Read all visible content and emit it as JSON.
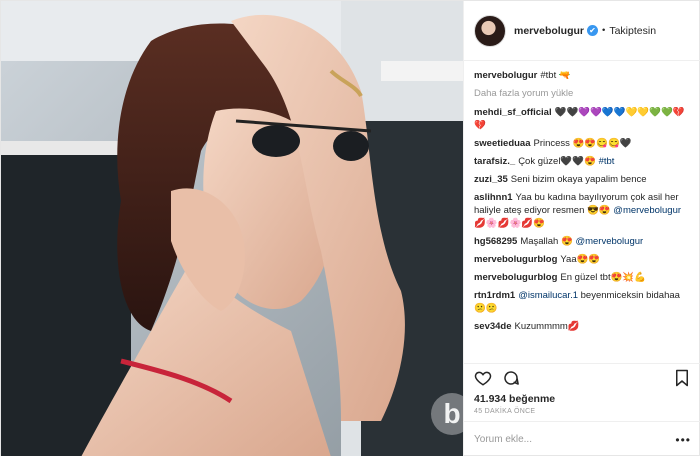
{
  "header": {
    "username": "mervebolugur",
    "verified_glyph": "✔",
    "separator": "•",
    "follow_label": "Takiptesin"
  },
  "caption": {
    "user": "mervebolugur",
    "text": "#tbt 🔫"
  },
  "load_more": "Daha fazla yorum yükle",
  "comments": [
    {
      "user": "mehdi_sf_official",
      "text": "🖤🖤💜💜💙💙💛💛💚💚💔💔"
    },
    {
      "user": "sweetieduaa",
      "text": "Princess 😍😍😋😋🖤"
    },
    {
      "user": "tarafsiz._",
      "text": "Çok güzel🖤🖤😍",
      "tag": "#tbt"
    },
    {
      "user": "zuzi_35",
      "text": "Seni bizim okaya yapalim bence"
    },
    {
      "user": "aslihnn1",
      "text": "Yaa bu kadına bayılıyorum çok asil her haliyle ateş ediyor resmen 😎😍",
      "mention": "@mervebolugur",
      "tail": "💋🌸💋🌸💋😍"
    },
    {
      "user": "hg568295",
      "text": "Maşallah 😍",
      "mention": "@mervebolugur"
    },
    {
      "user": "mervebolugurblog",
      "text": "Yaa😍😍"
    },
    {
      "user": "mervebolugurblog",
      "text": "En güzel tbt😍💥💪"
    },
    {
      "user": "rtn1rdm1",
      "mention": "@ismailucar.1",
      "text": "beyenmiceksin bidahaa😕😕"
    },
    {
      "user": "sev34de",
      "text": "Kuzummmm💋"
    }
  ],
  "actions": {
    "like_icon": "heart-icon",
    "comment_icon": "comment-icon",
    "save_icon": "bookmark-icon"
  },
  "likes": {
    "count": "41.934",
    "label": "beğenme"
  },
  "time_ago": "45 DAKİKA ÖNCE",
  "add_comment": {
    "placeholder": "Yorum ekle...",
    "more": "•••"
  },
  "watermark": "b",
  "colors": {
    "link": "#003569",
    "muted": "#999999",
    "verified": "#3897f0",
    "text": "#262626"
  }
}
